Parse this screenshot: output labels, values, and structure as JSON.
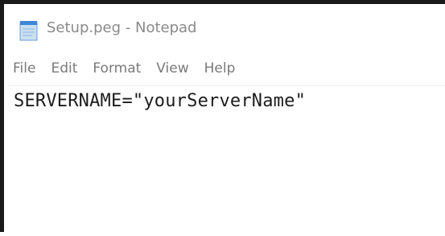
{
  "window": {
    "title": "Setup.peg - Notepad",
    "icon": "notepad-icon"
  },
  "menu": {
    "items": [
      {
        "label": "File"
      },
      {
        "label": "Edit"
      },
      {
        "label": "Format"
      },
      {
        "label": "View"
      },
      {
        "label": "Help"
      }
    ]
  },
  "editor": {
    "content": "SERVERNAME=\"yourServerName\""
  }
}
